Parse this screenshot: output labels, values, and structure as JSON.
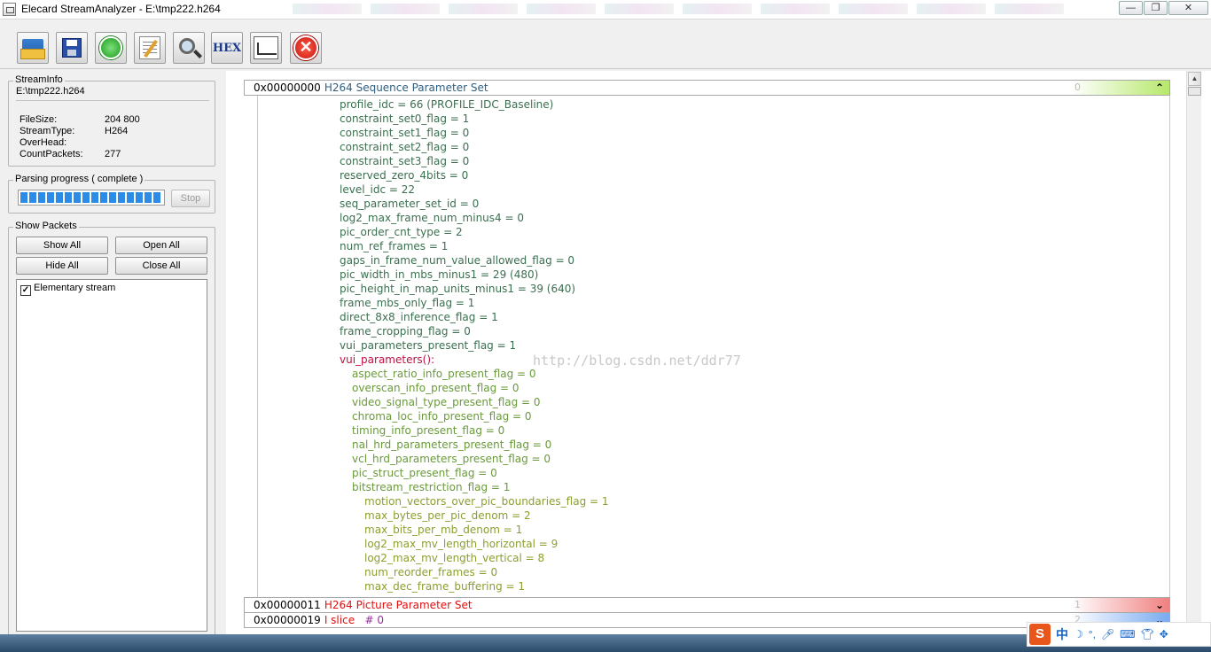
{
  "window": {
    "title": "Elecard StreamAnalyzer - E:\\tmp222.h264",
    "min_icon": "0",
    "max_icon": "1",
    "close_icon": "r"
  },
  "toolbar": {
    "buttons": [
      {
        "name": "open-file-icon"
      },
      {
        "name": "save-icon"
      },
      {
        "name": "refresh-icon"
      },
      {
        "name": "edit-icon"
      },
      {
        "name": "search-icon"
      },
      {
        "name": "hex-icon",
        "label": "HEX"
      },
      {
        "name": "graph-icon"
      },
      {
        "name": "stop-icon",
        "label": "✕"
      }
    ]
  },
  "stream_info": {
    "title": "StreamInfo",
    "path": "E:\\tmp222.h264",
    "rows": [
      {
        "key": "FileSize:",
        "value": "204 800"
      },
      {
        "key": "StreamType:",
        "value": "H264"
      },
      {
        "key": "OverHead:",
        "value": ""
      },
      {
        "key": "CountPackets:",
        "value": "277"
      }
    ]
  },
  "parsing": {
    "title": "Parsing progress ( complete )",
    "progress": 1.0,
    "stop_label": "Stop"
  },
  "show_packets": {
    "title": "Show Packets",
    "show_all": "Show All",
    "open_all": "Open All",
    "hide_all": "Hide All",
    "close_all": "Close All",
    "tree_items": [
      {
        "label": "Elementary stream",
        "checked": true,
        "check_mark": "✓"
      }
    ]
  },
  "packets": [
    {
      "addr": "0x00000000",
      "name": "H264 Sequence Parameter Set",
      "index": "0",
      "name_color": "#2f5f7f",
      "grad": "#b6e86a",
      "chevron": "⌃"
    },
    {
      "addr": "0x00000011",
      "name": "H264 Picture Parameter Set",
      "index": "1",
      "name_color": "#e01010",
      "grad": "#f08080",
      "chevron": "⌄"
    },
    {
      "addr": "0x00000019",
      "name": "I  slice",
      "extra": "# 0",
      "index": "2",
      "name_color": "#e01010",
      "extra_color": "#9a2aa0",
      "grad": "#7aaaf0",
      "chevron": "⌄"
    }
  ],
  "sps_fields": [
    {
      "text": "profile_idc = 66 (PROFILE_IDC_Baseline)",
      "level": 0,
      "color": "#3a6f4f"
    },
    {
      "text": "constraint_set0_flag = 1",
      "level": 0,
      "color": "#3a6f4f"
    },
    {
      "text": "constraint_set1_flag = 0",
      "level": 0,
      "color": "#3a6f4f"
    },
    {
      "text": "constraint_set2_flag = 0",
      "level": 0,
      "color": "#3a6f4f"
    },
    {
      "text": "constraint_set3_flag = 0",
      "level": 0,
      "color": "#3a6f4f"
    },
    {
      "text": "reserved_zero_4bits = 0",
      "level": 0,
      "color": "#3a6f4f"
    },
    {
      "text": "level_idc = 22",
      "level": 0,
      "color": "#3a6f4f"
    },
    {
      "text": "seq_parameter_set_id = 0",
      "level": 0,
      "color": "#3a6f4f"
    },
    {
      "text": "log2_max_frame_num_minus4 = 0",
      "level": 0,
      "color": "#3a6f4f"
    },
    {
      "text": "pic_order_cnt_type = 2",
      "level": 0,
      "color": "#3a6f4f"
    },
    {
      "text": "num_ref_frames = 1",
      "level": 0,
      "color": "#3a6f4f"
    },
    {
      "text": "gaps_in_frame_num_value_allowed_flag = 0",
      "level": 0,
      "color": "#3a6f4f"
    },
    {
      "text": "pic_width_in_mbs_minus1 = 29 (480)",
      "level": 0,
      "color": "#3a6f4f"
    },
    {
      "text": "pic_height_in_map_units_minus1 = 39 (640)",
      "level": 0,
      "color": "#3a6f4f"
    },
    {
      "text": "frame_mbs_only_flag = 1",
      "level": 0,
      "color": "#3a6f4f"
    },
    {
      "text": "direct_8x8_inference_flag = 1",
      "level": 0,
      "color": "#3a6f4f"
    },
    {
      "text": "frame_cropping_flag = 0",
      "level": 0,
      "color": "#3a6f4f"
    },
    {
      "text": "vui_parameters_present_flag = 1",
      "level": 0,
      "color": "#3a6f4f"
    },
    {
      "text": "vui_parameters():",
      "level": 0,
      "color": "#c01040"
    },
    {
      "text": "aspect_ratio_info_present_flag = 0",
      "level": 1,
      "color": "#6a9a3a"
    },
    {
      "text": "overscan_info_present_flag = 0",
      "level": 1,
      "color": "#6a9a3a"
    },
    {
      "text": "video_signal_type_present_flag = 0",
      "level": 1,
      "color": "#6a9a3a"
    },
    {
      "text": "chroma_loc_info_present_flag = 0",
      "level": 1,
      "color": "#6a9a3a"
    },
    {
      "text": "timing_info_present_flag = 0",
      "level": 1,
      "color": "#6a9a3a"
    },
    {
      "text": "nal_hrd_parameters_present_flag = 0",
      "level": 1,
      "color": "#6a9a3a"
    },
    {
      "text": "vcl_hrd_parameters_present_flag = 0",
      "level": 1,
      "color": "#6a9a3a"
    },
    {
      "text": "pic_struct_present_flag  = 0",
      "level": 1,
      "color": "#6a9a3a"
    },
    {
      "text": "bitstream_restriction_flag = 1",
      "level": 1,
      "color": "#6a9a3a"
    },
    {
      "text": "motion_vectors_over_pic_boundaries_flag = 1",
      "level": 2,
      "color": "#8aa030"
    },
    {
      "text": "max_bytes_per_pic_denom = 2",
      "level": 2,
      "color": "#8aa030"
    },
    {
      "text": "max_bits_per_mb_denom = 1",
      "level": 2,
      "color": "#8aa030"
    },
    {
      "text": "log2_max_mv_length_horizontal = 9",
      "level": 2,
      "color": "#8aa030"
    },
    {
      "text": "log2_max_mv_length_vertical = 8",
      "level": 2,
      "color": "#8aa030"
    },
    {
      "text": "num_reorder_frames = 0",
      "level": 2,
      "color": "#8aa030"
    },
    {
      "text": "max_dec_frame_buffering = 1",
      "level": 2,
      "color": "#8aa030"
    }
  ],
  "watermark": "http://blog.csdn.net/ddr77",
  "scrollbar": {
    "up": "▲",
    "down": "▼"
  },
  "tray": {
    "ime_logo": "S",
    "ime_lang": "中",
    "icons": [
      "moon-icon",
      "punctuation-icon",
      "mic-icon",
      "keyboard-icon",
      "shirt-icon",
      "tools-icon"
    ]
  }
}
